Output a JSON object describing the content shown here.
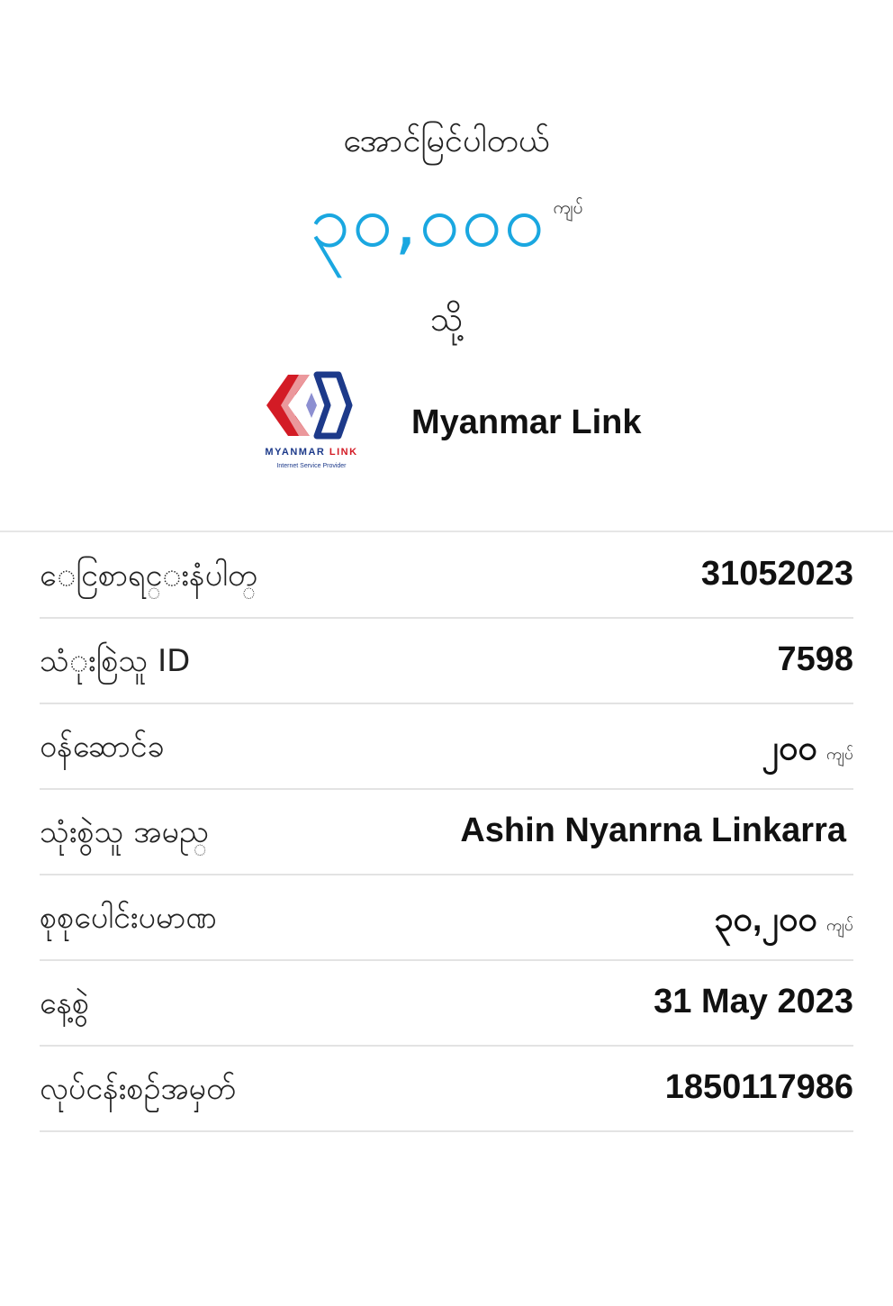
{
  "receipt": {
    "status_text": "အောင်မြင်ပါတယ်",
    "amount": "၃၀,၀၀၀",
    "currency": "ကျပ်",
    "to_text": "သို့",
    "logo": {
      "word_part1": "MYANMAR",
      "word_part2": "LINK",
      "tagline": "Internet Service Provider"
    },
    "merchant_name": "Myanmar Link"
  },
  "details": {
    "rows": [
      {
        "label": "ေငြစာရင္းနံပါတ္",
        "value": "31052023",
        "unit": ""
      },
      {
        "label": "သံုးစြဲသူ ID",
        "value": "7598",
        "unit": ""
      },
      {
        "label": "ဝန်ဆောင်ခ",
        "value": "၂၀၀",
        "unit": "ကျပ်"
      },
      {
        "label": "သုံးစွဲသူ အမည္",
        "value": "Ashin Nyanrna Linkarra",
        "unit": ""
      },
      {
        "label": "စုစုပေါင်းပမာဏ",
        "value": "၃၀,၂၀၀",
        "unit": "ကျပ်"
      },
      {
        "label": "နေ့စွဲ",
        "value": "31 May 2023",
        "unit": ""
      },
      {
        "label": "လုပ်ငန်းစဉ်အမှတ်",
        "value": "1850117986",
        "unit": ""
      }
    ]
  },
  "colors": {
    "amount": "#1aa7e0",
    "logo_red": "#d31b25",
    "logo_blue": "#1d3a8a"
  }
}
